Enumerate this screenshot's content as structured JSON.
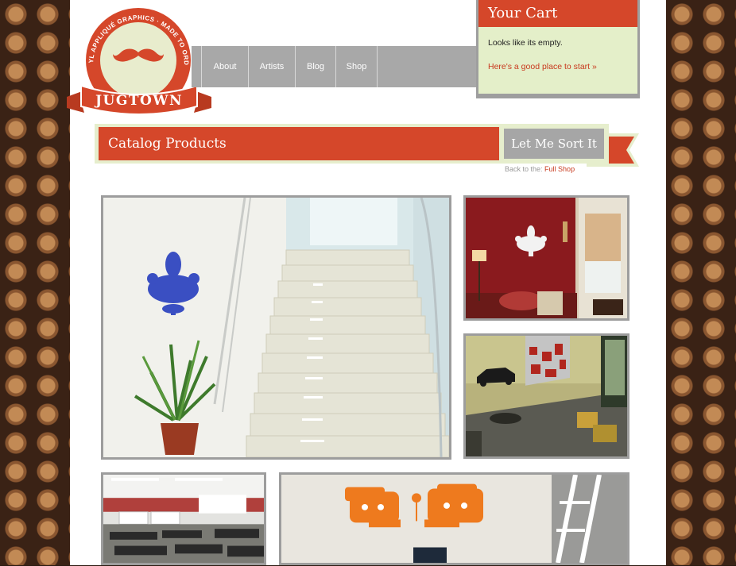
{
  "logo": {
    "arc_text": "VINYL APPLIQUÉ GRAPHICS · MADE TO ORDER",
    "brand": "JUGTOWN",
    "icon": "mustache-icon"
  },
  "nav": {
    "items": [
      {
        "label": "About"
      },
      {
        "label": "Artists"
      },
      {
        "label": "Blog"
      },
      {
        "label": "Shop"
      }
    ]
  },
  "cart": {
    "title": "Your Cart",
    "empty_text": "Looks like its empty.",
    "start_link": "Here's a good place to start »"
  },
  "catalog": {
    "title": "Catalog Products",
    "sort_button": "Let Me Sort It",
    "back_prefix": "Back to the:",
    "back_link": "Full Shop"
  },
  "colors": {
    "accent": "#d5472a",
    "cream": "#e4efc9",
    "frame": "#9d9d9d"
  }
}
